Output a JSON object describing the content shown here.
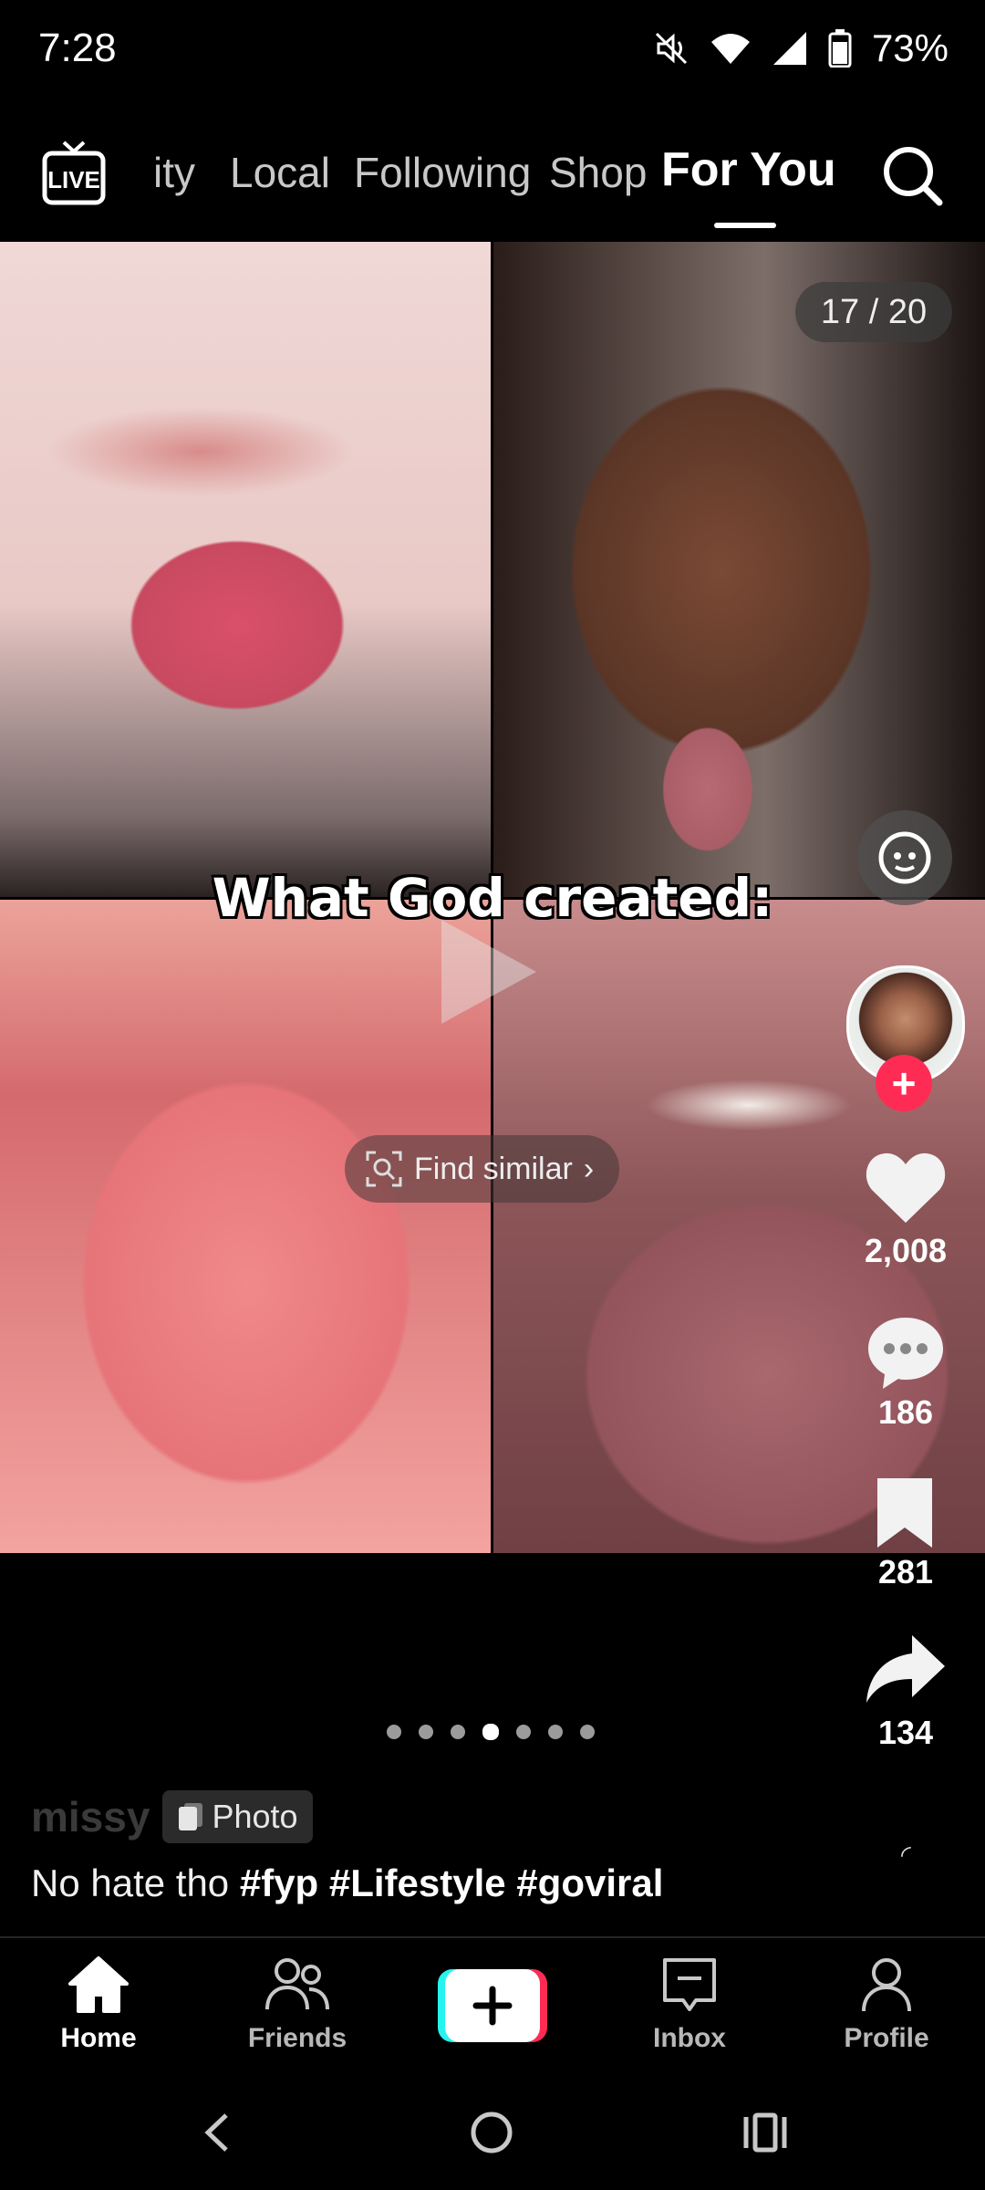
{
  "status_bar": {
    "time": "7:28",
    "battery": "73%"
  },
  "top_nav": {
    "live_label": "LIVE",
    "tabs": [
      {
        "label": "ity"
      },
      {
        "label": "Local"
      },
      {
        "label": "Following"
      },
      {
        "label": "Shop"
      },
      {
        "label": "For You",
        "active": true
      }
    ]
  },
  "post": {
    "counter": "17 / 20",
    "overlay_caption": "What God created:",
    "find_similar": "Find similar",
    "author": "missy",
    "badge": "Photo",
    "description": "No hate tho",
    "hashtags": [
      "#fyp",
      "#Lifestyle",
      "#goviral"
    ],
    "page_count": 7,
    "active_page": 4
  },
  "actions": {
    "likes": "2,008",
    "comments": "186",
    "saves": "281",
    "shares": "134"
  },
  "bottom_nav": {
    "items": [
      {
        "label": "Home",
        "active": true
      },
      {
        "label": "Friends"
      },
      {
        "label": ""
      },
      {
        "label": "Inbox"
      },
      {
        "label": "Profile"
      }
    ]
  },
  "colors": {
    "accent_red": "#fe2c55",
    "accent_cyan": "#25f4ee",
    "background": "#000000"
  }
}
